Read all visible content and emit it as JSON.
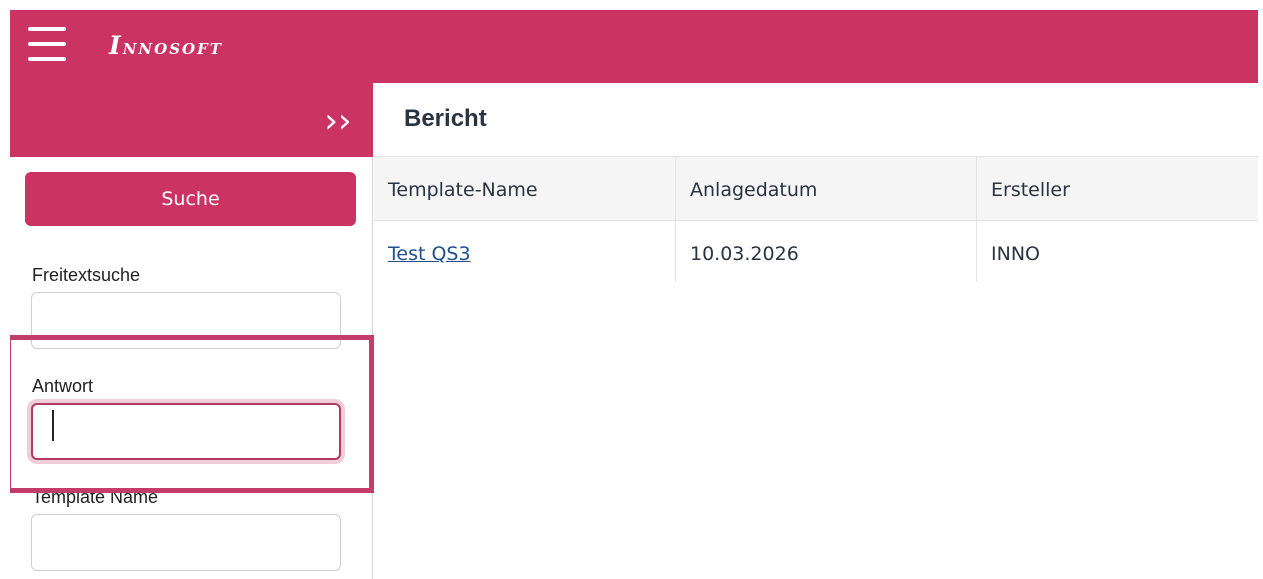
{
  "topbar": {
    "logo_text": "INNOSOFT",
    "logo_first": "I",
    "logo_rest": "NNOSOFT"
  },
  "sidebar": {
    "search_button_label": "Suche",
    "fields": [
      {
        "label": "Freitextsuche",
        "value": ""
      },
      {
        "label": "Antwort",
        "value": ""
      },
      {
        "label": "Template Name",
        "value": ""
      }
    ]
  },
  "main": {
    "title": "Bericht",
    "columns": [
      "Template-Name",
      "Anlagedatum",
      "Ersteller"
    ],
    "rows": [
      [
        "Test QS3",
        "10.03.2026",
        "INNO"
      ]
    ]
  },
  "colors": {
    "brand": "#cb3363",
    "highlight": "#c43c6a",
    "link": "#1f4f8f"
  }
}
